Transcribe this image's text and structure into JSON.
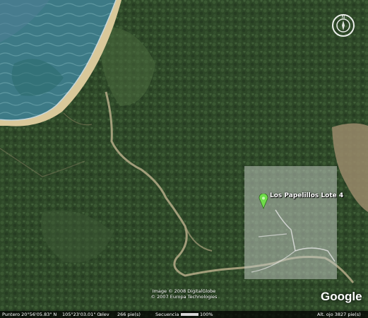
{
  "map": {
    "placemark_label": "Los Papelillos Lote 4",
    "credits_line1": "Image © 2008 DigitalGlobe",
    "credits_line2": "© 2007 Europa Technologies",
    "logo_text": "Google"
  },
  "status_bar": {
    "pointer": "Puntero  20°56'05.83\" N",
    "longitude": "105°23'03.01\" O",
    "elevation_label": "elev",
    "elevation": "266 pie(s)",
    "streaming_label": "Secuencia",
    "streaming_percent": "100%",
    "streaming_progress": 1.0,
    "eye_altitude": "Alt. ojo    3827 pie(s)"
  },
  "colors": {
    "ocean": "#3f7f8a",
    "beach": "#d9c89a",
    "forest": "#2f4a2a",
    "placemark": "#6fdc4a"
  },
  "icons": {
    "compass": "compass-icon",
    "placemark": "green-placemark-icon"
  }
}
